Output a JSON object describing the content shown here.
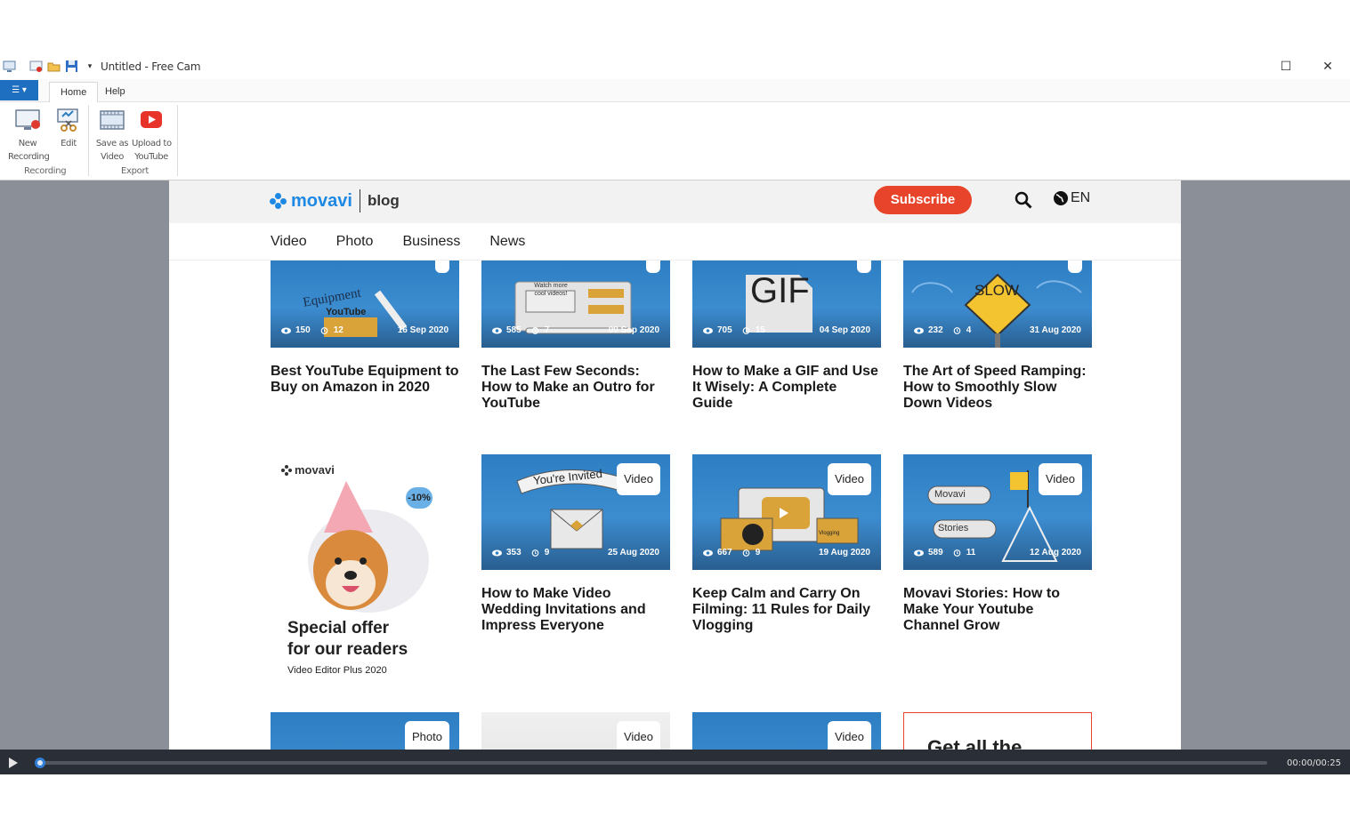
{
  "window": {
    "title": "Untitled - Free Cam",
    "maximize": "☐",
    "close": "✕"
  },
  "menu": {
    "file_label": "☰ ▾",
    "tabs": [
      {
        "label": "Home",
        "active": true
      },
      {
        "label": "Help",
        "active": false
      }
    ]
  },
  "ribbon": {
    "buttons": [
      {
        "label": "New\nRecording",
        "icon": "new-recording-icon"
      },
      {
        "label": "Edit",
        "icon": "edit-icon"
      },
      {
        "label": "Save as\nVideo",
        "icon": "save-video-icon"
      },
      {
        "label": "Upload to\nYouTube",
        "icon": "youtube-icon"
      }
    ],
    "groups": [
      "Recording",
      "Export"
    ]
  },
  "site": {
    "logo": "movavi",
    "logo_section": "blog",
    "subscribe": "Subscribe",
    "lang": "EN",
    "nav": [
      "Video",
      "Photo",
      "Business",
      "News"
    ]
  },
  "cards_row1": [
    {
      "views": "150",
      "minutes": "12",
      "date": "16 Sep 2020",
      "title": "Best YouTube Equipment to Buy on Amazon in 2020",
      "art": "YouTube"
    },
    {
      "views": "585",
      "minutes": "7",
      "date": "09 Sep 2020",
      "title": "The Last Few Seconds: How to Make an Outro for YouTube",
      "art": "Watch more cool videos!"
    },
    {
      "views": "705",
      "minutes": "15",
      "date": "04 Sep 2020",
      "title": "How to Make a GIF and Use It Wisely: A Complete Guide",
      "art": "GIF"
    },
    {
      "views": "232",
      "minutes": "4",
      "date": "31 Aug 2020",
      "title": "The Art of Speed Ramping: How to Smoothly Slow Down Videos",
      "art": "SLOW"
    }
  ],
  "cards_row2": [
    {
      "badge": "Video",
      "views": "353",
      "minutes": "9",
      "date": "25 Aug 2020",
      "title": "How to Make Video Wedding Invitations and Impress Everyone",
      "art": "You're Invited"
    },
    {
      "badge": "Video",
      "views": "667",
      "minutes": "9",
      "date": "19 Aug 2020",
      "title": "Keep Calm and Carry On Filming: 11 Rules for Daily Vlogging",
      "art": "Vlogging"
    },
    {
      "badge": "Video",
      "views": "589",
      "minutes": "11",
      "date": "12 Aug 2020",
      "title": "Movavi Stories: How to Make Your Youtube Channel Grow",
      "art_top": "Movavi",
      "art_bottom": "Stories"
    }
  ],
  "promo": {
    "brand": "movavi",
    "discount": "-10%",
    "headline_1": "Special offer",
    "headline_2": "for our readers",
    "product": "Video Editor Plus 2020"
  },
  "cards_row3": [
    {
      "badge": "Photo"
    },
    {
      "badge": "Video"
    },
    {
      "badge": "Video"
    }
  ],
  "bottom_box_text": "Get all the",
  "player": {
    "time": "00:00/00:25",
    "progress": 0.0
  }
}
